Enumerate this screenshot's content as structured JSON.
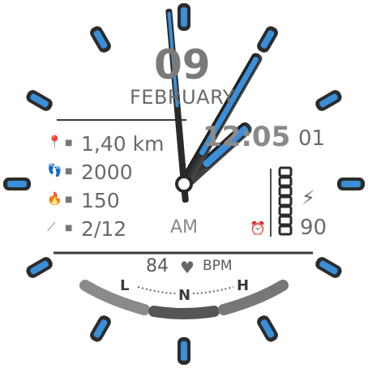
{
  "date": {
    "day": "09",
    "month": "FEBRUARY"
  },
  "stats": [
    {
      "name": "distance",
      "icon": "location-pin-icon",
      "value": "1,40 km"
    },
    {
      "name": "steps",
      "icon": "footsteps-icon",
      "value": "2000"
    },
    {
      "name": "calories",
      "icon": "flame-icon",
      "value": "150"
    },
    {
      "name": "floors",
      "icon": "stairs-icon",
      "value": "2/12"
    }
  ],
  "time": {
    "hhmm": "12:05",
    "seconds": "01",
    "ampm": "AM"
  },
  "battery": {
    "icon": "lightning-bolt-icon",
    "value": "90",
    "level_segments_filled": 7,
    "level_segments_total": 7
  },
  "alarm_icon": "alarm-clock-icon",
  "heart_rate": {
    "value": "84",
    "unit": "BPM",
    "icon": "heart-icon",
    "gauge_low": "L",
    "gauge_normal": "N",
    "gauge_high": "H"
  },
  "colors": {
    "accent_blue": "#3a8fd8",
    "hand_dark": "#2b2b2b",
    "text_gray": "#6f6f6f"
  }
}
